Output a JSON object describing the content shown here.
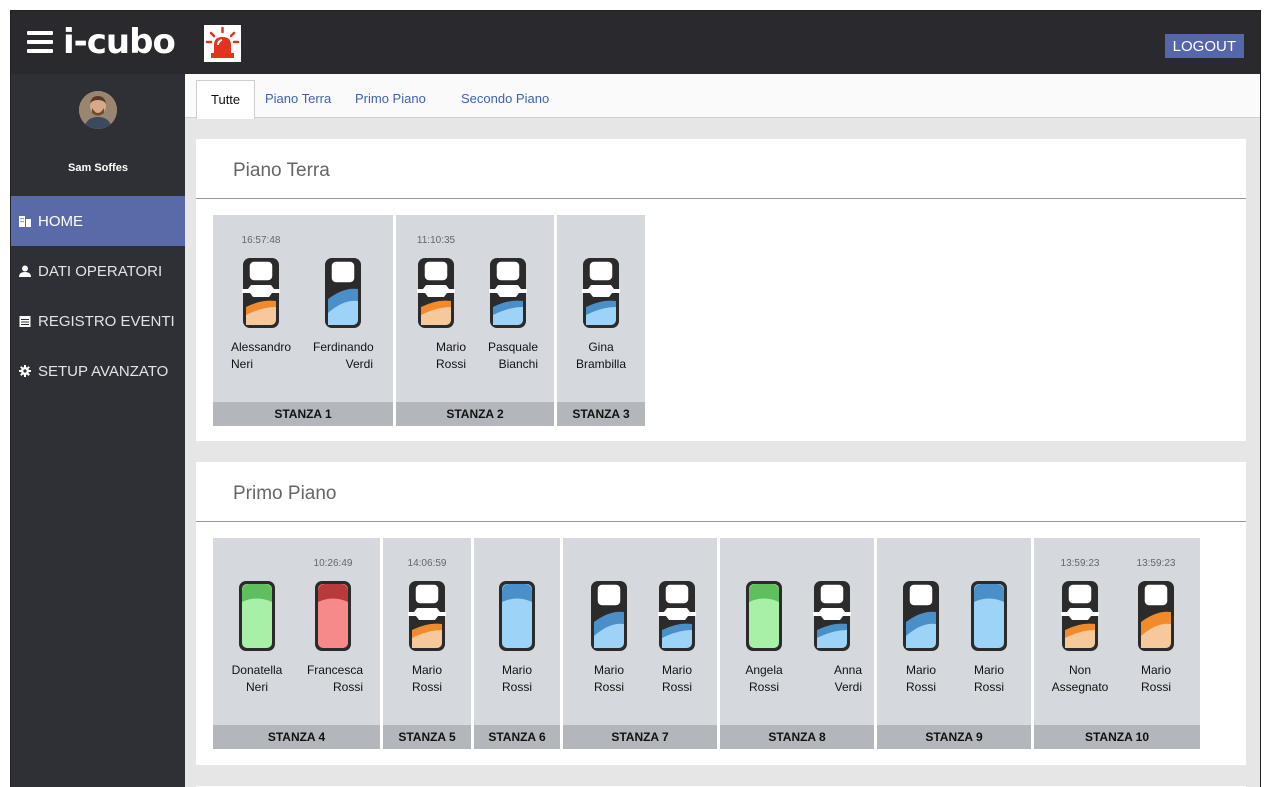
{
  "app": {
    "logo": "i-cubo",
    "logout_label": "LOGOUT"
  },
  "user": {
    "name": "Sam Soffes"
  },
  "sidebar": {
    "items": [
      {
        "label": "HOME",
        "icon": "building-icon",
        "active": true
      },
      {
        "label": "DATI OPERATORI",
        "icon": "user-icon",
        "active": false
      },
      {
        "label": "REGISTRO EVENTI",
        "icon": "calendar-icon",
        "active": false
      },
      {
        "label": "SETUP AVANZATO",
        "icon": "gear-icon",
        "active": false
      }
    ]
  },
  "tabs": [
    {
      "label": "Tutte",
      "active": true
    },
    {
      "label": "Piano Terra",
      "active": false
    },
    {
      "label": "Primo Piano",
      "active": false
    },
    {
      "label": "Secondo Piano",
      "active": false
    }
  ],
  "colors": {
    "orange": "#f08a2a",
    "peach": "#f7c89c",
    "blue": "#4a8fc8",
    "lightblue": "#9dd3f7",
    "green": "#5fbf5f",
    "lightgreen": "#a8f0a8",
    "red": "#b83a3a",
    "pink": "#f68a8a",
    "alarm_red": "#e0341f",
    "accent": "#5a6aa8"
  },
  "floors": [
    {
      "title": "Piano Terra",
      "rooms": [
        {
          "label": "STANZA 1",
          "beds": [
            {
              "time": "16:57:48",
              "first": "Alessandro",
              "last": "Neri",
              "align": "left",
              "icon": "bed-orange-icon",
              "color": "orange",
              "style": "full"
            },
            {
              "time": "",
              "first": "Ferdinando",
              "last": "Verdi",
              "align": "right",
              "icon": "bed-blue-icon",
              "color": "blue",
              "style": "plain"
            }
          ]
        },
        {
          "label": "STANZA 2",
          "beds": [
            {
              "time": "11:10:35",
              "first": "Mario",
              "last": "Rossi",
              "align": "right",
              "icon": "bed-orange-icon",
              "color": "orange",
              "style": "full"
            },
            {
              "time": "",
              "first": "Pasquale",
              "last": "Bianchi",
              "align": "right",
              "icon": "bed-blue-icon",
              "color": "blue",
              "style": "full"
            }
          ]
        },
        {
          "label": "STANZA 3",
          "beds": [
            {
              "time": "",
              "first": "Gina",
              "last": "Brambilla",
              "align": "center",
              "icon": "bed-blue-icon",
              "color": "blue",
              "style": "full"
            }
          ]
        }
      ]
    },
    {
      "title": "Primo Piano",
      "rooms": [
        {
          "label": "STANZA 4",
          "beds": [
            {
              "time": "",
              "first": "Donatella",
              "last": "Neri",
              "align": "center",
              "icon": "bed-green-icon",
              "color": "green",
              "style": "solid"
            },
            {
              "time": "10:26:49",
              "first": "Francesca",
              "last": "Rossi",
              "align": "right",
              "icon": "bed-red-icon",
              "color": "red",
              "style": "solid"
            }
          ]
        },
        {
          "label": "STANZA 5",
          "beds": [
            {
              "time": "14:06:59",
              "first": "Mario",
              "last": "Rossi",
              "align": "center",
              "icon": "bed-orange-icon",
              "color": "orange",
              "style": "full"
            }
          ]
        },
        {
          "label": "STANZA 6",
          "beds": [
            {
              "time": "",
              "first": "Mario",
              "last": "Rossi",
              "align": "center",
              "icon": "bed-blue-icon",
              "color": "blue",
              "style": "solid"
            }
          ]
        },
        {
          "label": "STANZA 7",
          "beds": [
            {
              "time": "",
              "first": "Mario",
              "last": "Rossi",
              "align": "center",
              "icon": "bed-blue-icon",
              "color": "blue",
              "style": "plain"
            },
            {
              "time": "",
              "first": "Mario",
              "last": "Rossi",
              "align": "center",
              "icon": "bed-blue-icon",
              "color": "blue",
              "style": "full"
            }
          ]
        },
        {
          "label": "STANZA 8",
          "beds": [
            {
              "time": "",
              "first": "Angela",
              "last": "Rossi",
              "align": "center",
              "icon": "bed-green-icon",
              "color": "green",
              "style": "solid"
            },
            {
              "time": "",
              "first": "Anna",
              "last": "Verdi",
              "align": "right",
              "icon": "bed-blue-icon",
              "color": "blue",
              "style": "full"
            }
          ]
        },
        {
          "label": "STANZA 9",
          "beds": [
            {
              "time": "",
              "first": "Mario",
              "last": "Rossi",
              "align": "center",
              "icon": "bed-blue-icon",
              "color": "blue",
              "style": "plain"
            },
            {
              "time": "",
              "first": "Mario",
              "last": "Rossi",
              "align": "center",
              "icon": "bed-blue-icon",
              "color": "blue",
              "style": "solid"
            }
          ]
        },
        {
          "label": "STANZA 10",
          "beds": [
            {
              "time": "13:59:23",
              "first": "Non",
              "last": "Assegnato",
              "align": "center",
              "icon": "bed-orange-icon",
              "color": "orange",
              "style": "full"
            },
            {
              "time": "13:59:23",
              "first": "Mario",
              "last": "Rossi",
              "align": "center",
              "icon": "bed-orange-icon",
              "color": "orange",
              "style": "plain"
            }
          ]
        }
      ]
    }
  ]
}
